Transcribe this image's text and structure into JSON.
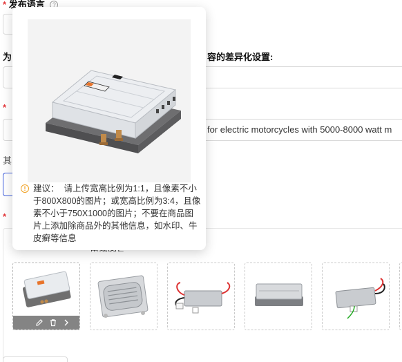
{
  "form": {
    "publish_lang_label": "发布语言",
    "diff_settings_label": "为",
    "diff_settings_suffix": "容的差异化设置:",
    "title_value": "for electric motorcycles with 5000-8000 watt m",
    "other_label": "其",
    "images_partial_label": "更多图片"
  },
  "popup": {
    "tip_label": "建议：",
    "tip_text": "请上传宽高比例为1:1，且像素不小于800X800的图片；或宽高比例为3:4，且像素不小于750X1000的图片；不要在商品图片上添加除商品外的其他信息，如水印、牛皮癣等信息"
  },
  "thumbnails": [
    {
      "name": "controller-top-view",
      "selected": true
    },
    {
      "name": "controller-heatsink"
    },
    {
      "name": "controller-with-wires"
    },
    {
      "name": "controller-side"
    },
    {
      "name": "controller-wiring-harness"
    }
  ],
  "icons": {
    "help": "help-icon",
    "info": "info-icon",
    "edit": "edit-icon",
    "delete": "trash-icon",
    "next": "chevron-right-icon"
  },
  "colors": {
    "required": "#e4393c",
    "warning": "#f0a020",
    "accent": "#3b5bdb"
  }
}
